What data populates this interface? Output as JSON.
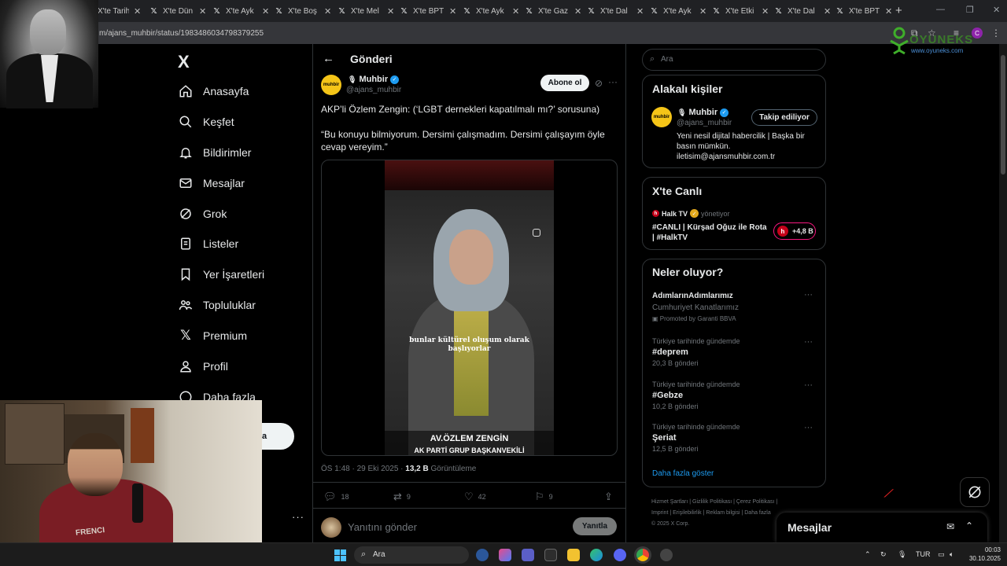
{
  "browser": {
    "tabs": [
      {
        "label": "X'te Tarih"
      },
      {
        "label": "X'te Dün"
      },
      {
        "label": "X'te Ayk"
      },
      {
        "label": "X'te Boş"
      },
      {
        "label": "X'te Mel"
      },
      {
        "label": "X'te BPT"
      },
      {
        "label": "X'te Ayk"
      },
      {
        "label": "X'te Gaz"
      },
      {
        "label": "X'te Dal"
      },
      {
        "label": "X'te Ayk"
      },
      {
        "label": "X'te Etki"
      },
      {
        "label": "X'te Dal"
      },
      {
        "label": "X'te BPT"
      }
    ],
    "url": "m/ajans_muhbir/status/1983486034798379255",
    "profile_initial": "C",
    "watermark_text": "OYUNEKS",
    "watermark_sub": "www.oyuneks.com"
  },
  "nav": {
    "logo": "X",
    "items": [
      {
        "label": "Anasayfa"
      },
      {
        "label": "Keşfet"
      },
      {
        "label": "Bildirimler"
      },
      {
        "label": "Mesajlar"
      },
      {
        "label": "Grok"
      },
      {
        "label": "Listeler"
      },
      {
        "label": "Yer İşaretleri"
      },
      {
        "label": "Topluluklar"
      },
      {
        "label": "Premium"
      },
      {
        "label": "Profil"
      },
      {
        "label": "Daha fazla"
      }
    ],
    "post_button_partial": "a",
    "more": "···"
  },
  "post": {
    "header_title": "Gönderi",
    "author_name": "Muhbir",
    "author_handle": "@ajans_muhbir",
    "avatar_text": "muhbir",
    "subscribe_label": "Abone ol",
    "text_line1": "AKP’li Özlem Zengin: (‘LGBT dernekleri kapatılmalı mı?’ sorusuna)",
    "text_line2": "“Bu konuyu bilmiyorum. Dersimi çalışmadım. Dersimi çalışayım öyle cevap vereyim.”",
    "video_subtitle_1": "bunlar kültürel oluşum olarak",
    "video_subtitle_2": "başlıyorlar",
    "video_name": "AV.ÖZLEM ZENGİN",
    "video_title": "AK PARTİ GRUP BAŞKANVEKİLİ",
    "time": "ÖS 1:48 · 29 Eki 2025 · ",
    "views": "13,2 B",
    "views_label": " Görüntüleme",
    "replies": "18",
    "reposts": "9",
    "likes": "42",
    "bookmarks": "9",
    "reply_placeholder": "Yanıtını gönder",
    "reply_button": "Yanıtla"
  },
  "right": {
    "search_placeholder": "Ara",
    "related_title": "Alakalı kişiler",
    "related_name": "Muhbir",
    "related_handle": "@ajans_muhbir",
    "follow_label": "Takip ediliyor",
    "related_bio_1": "Yeni nesil dijital habercilik | Başka bir",
    "related_bio_2": "basın mümkün.",
    "related_bio_3": "iletisim@ajansmuhbir.com.tr",
    "live_title": "X'te Canlı",
    "live_host": "Halk TV",
    "live_role": "yönetiyor",
    "live_text_1": "#CANLI | Kürşad Oğuz ile Rota",
    "live_text_2": "| #HalkTV",
    "live_count": "+4,8 B",
    "trends_title": "Neler oluyor?",
    "trends": [
      {
        "category": "",
        "name": "AdımlarınAdımlarımız",
        "count": "Cumhuriyet Kanatlarımız",
        "promo": "Promoted by Garanti BBVA"
      },
      {
        "category": "Türkiye tarihinde gündemde",
        "name": "#deprem",
        "count": "20,3 B gönderi"
      },
      {
        "category": "Türkiye tarihinde gündemde",
        "name": "#Gebze",
        "count": "10,2 B gönderi"
      },
      {
        "category": "Türkiye tarihinde gündemde",
        "name": "Şeriat",
        "count": "12,5 B gönderi"
      }
    ],
    "show_more": "Daha fazla göster",
    "footer_1": "Hizmet Şartları  |  Gizlilik Politikası  |  Çerez Politikası  |",
    "footer_2": "Imprint  |  Erişilebilirlik  |  Reklam bilgisi  |  Daha fazla",
    "footer_3": "© 2025 X Corp."
  },
  "dm": {
    "title": "Mesajlar"
  },
  "webcam": {
    "shirt_text": "FRENCI"
  },
  "taskbar": {
    "search_placeholder": "Ara",
    "lang": "TUR",
    "time": "00:03",
    "date": "30.10.2025"
  },
  "colors": {
    "accent": "#1d9bf0",
    "live": "#f91880",
    "muhbir_avatar": "#f5c518"
  }
}
